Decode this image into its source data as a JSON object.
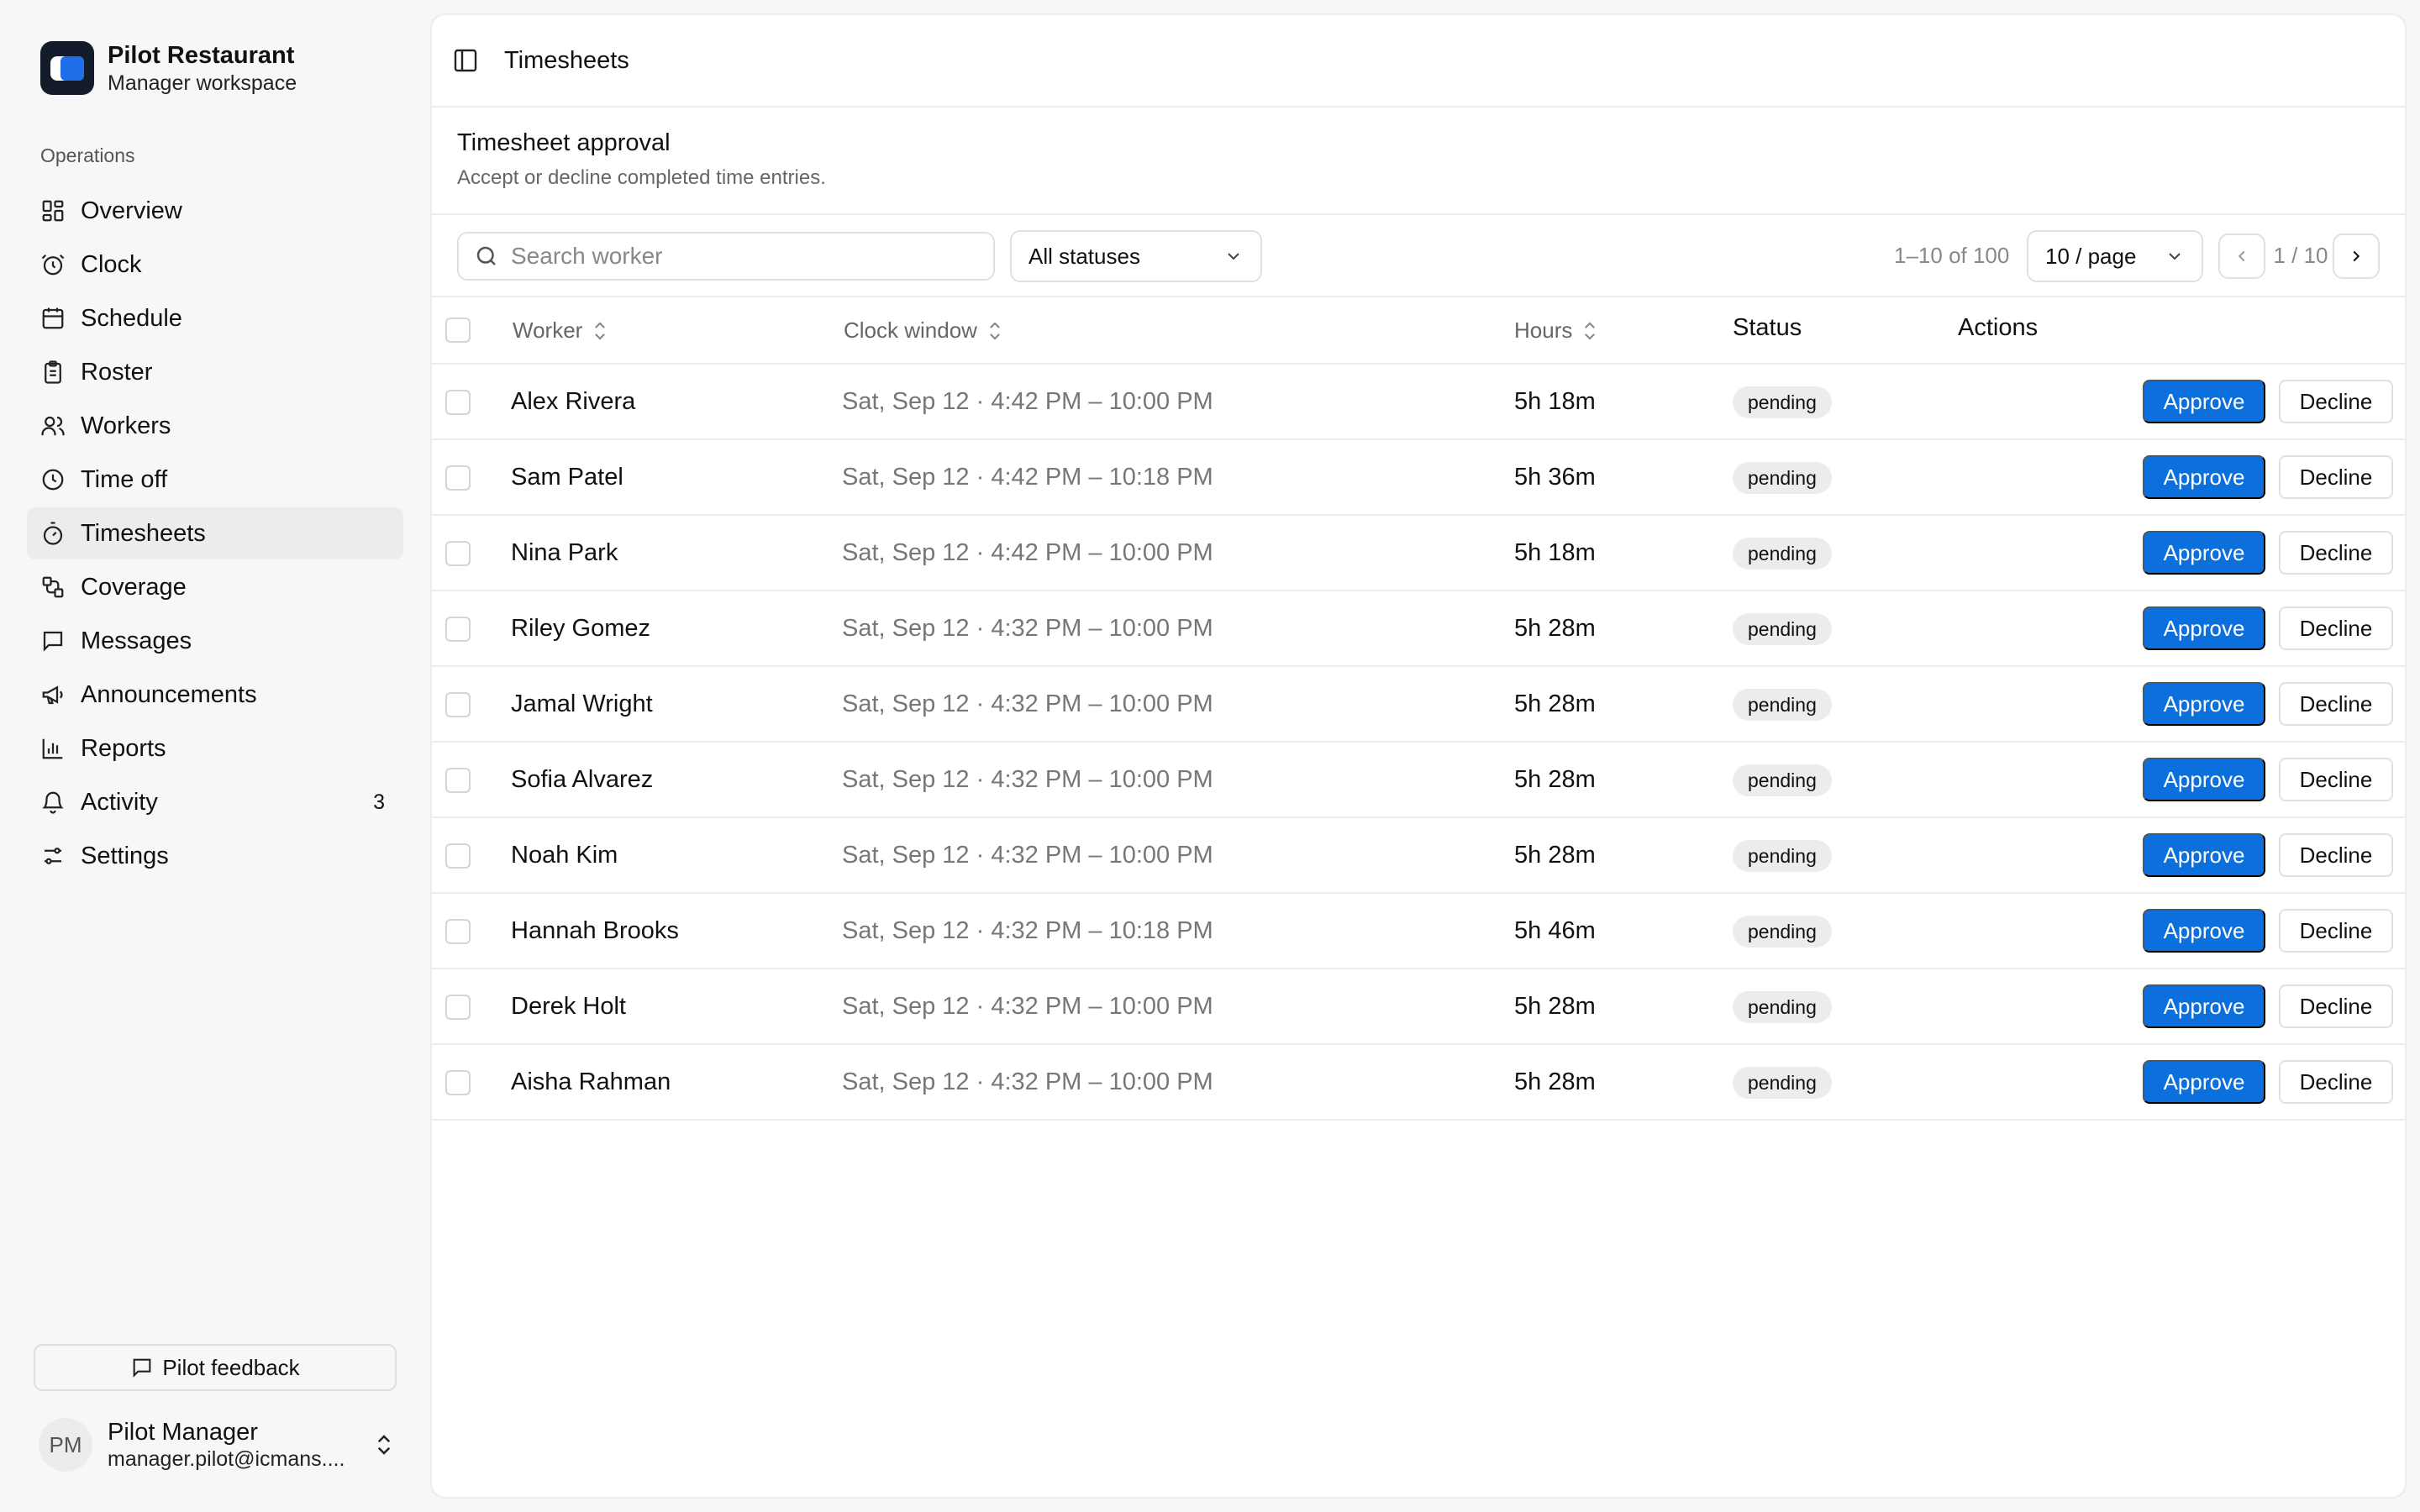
{
  "brand": {
    "name": "Pilot Restaurant",
    "subtitle": "Manager workspace"
  },
  "sidebar": {
    "section_label": "Operations",
    "items": [
      {
        "label": "Overview",
        "icon": "grid-icon"
      },
      {
        "label": "Clock",
        "icon": "alarm-clock-icon"
      },
      {
        "label": "Schedule",
        "icon": "calendar-icon"
      },
      {
        "label": "Roster",
        "icon": "clipboard-icon"
      },
      {
        "label": "Workers",
        "icon": "users-icon"
      },
      {
        "label": "Time off",
        "icon": "clock-icon"
      },
      {
        "label": "Timesheets",
        "icon": "stopwatch-icon",
        "active": true
      },
      {
        "label": "Coverage",
        "icon": "coverage-icon"
      },
      {
        "label": "Messages",
        "icon": "message-icon"
      },
      {
        "label": "Announcements",
        "icon": "megaphone-icon"
      },
      {
        "label": "Reports",
        "icon": "bar-chart-icon"
      },
      {
        "label": "Activity",
        "icon": "bell-icon",
        "badge": "3"
      },
      {
        "label": "Settings",
        "icon": "sliders-icon"
      }
    ],
    "feedback_label": "Pilot feedback",
    "user": {
      "initials": "PM",
      "name": "Pilot Manager",
      "email": "manager.pilot@icmans...."
    }
  },
  "topbar": {
    "breadcrumb": "Timesheets"
  },
  "page": {
    "title": "Timesheet approval",
    "subtitle": "Accept or decline completed time entries."
  },
  "toolbar": {
    "search_placeholder": "Search worker",
    "status_filter": "All statuses",
    "range_text": "1–10 of 100",
    "page_size": "10 / page",
    "page_indicator": "1 / 10"
  },
  "table": {
    "columns": {
      "worker": "Worker",
      "clock_window": "Clock window",
      "hours": "Hours",
      "status": "Status",
      "actions": "Actions"
    },
    "approve_label": "Approve",
    "decline_label": "Decline",
    "rows": [
      {
        "worker": "Alex Rivera",
        "window": "Sat, Sep 12 · 4:42 PM – 10:00 PM",
        "hours": "5h 18m",
        "status": "pending"
      },
      {
        "worker": "Sam Patel",
        "window": "Sat, Sep 12 · 4:42 PM – 10:18 PM",
        "hours": "5h 36m",
        "status": "pending"
      },
      {
        "worker": "Nina Park",
        "window": "Sat, Sep 12 · 4:42 PM – 10:00 PM",
        "hours": "5h 18m",
        "status": "pending"
      },
      {
        "worker": "Riley Gomez",
        "window": "Sat, Sep 12 · 4:32 PM – 10:00 PM",
        "hours": "5h 28m",
        "status": "pending"
      },
      {
        "worker": "Jamal Wright",
        "window": "Sat, Sep 12 · 4:32 PM – 10:00 PM",
        "hours": "5h 28m",
        "status": "pending"
      },
      {
        "worker": "Sofia Alvarez",
        "window": "Sat, Sep 12 · 4:32 PM – 10:00 PM",
        "hours": "5h 28m",
        "status": "pending"
      },
      {
        "worker": "Noah Kim",
        "window": "Sat, Sep 12 · 4:32 PM – 10:00 PM",
        "hours": "5h 28m",
        "status": "pending"
      },
      {
        "worker": "Hannah Brooks",
        "window": "Sat, Sep 12 · 4:32 PM – 10:18 PM",
        "hours": "5h 46m",
        "status": "pending"
      },
      {
        "worker": "Derek Holt",
        "window": "Sat, Sep 12 · 4:32 PM – 10:00 PM",
        "hours": "5h 28m",
        "status": "pending"
      },
      {
        "worker": "Aisha Rahman",
        "window": "Sat, Sep 12 · 4:32 PM – 10:00 PM",
        "hours": "5h 28m",
        "status": "pending"
      }
    ]
  },
  "colors": {
    "accent": "#0b6fdc",
    "brand_dark": "#141c2b",
    "pill_bg": "#ececec"
  }
}
